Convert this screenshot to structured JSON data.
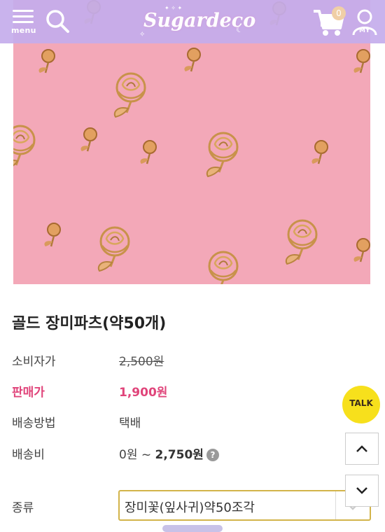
{
  "header": {
    "menu_label": "menu",
    "logo_text": "Sugardeco",
    "cart_count": "0",
    "my_label": "MY"
  },
  "product": {
    "title": "골드 장미파츠(약50개)",
    "retail_label": "소비자가",
    "retail_price": "2,500원",
    "sale_label": "판매가",
    "sale_price": "1,900원",
    "shipping_method_label": "배송방법",
    "shipping_method": "택배",
    "shipping_fee_label": "배송비",
    "shipping_fee_min": "0원 ~ ",
    "shipping_fee_max": "2,750원",
    "help_symbol": "?",
    "option_label": "종류",
    "option_selected": "장미꽃(잎사귀)약50조각"
  },
  "floating": {
    "talk_label": "TALK"
  },
  "colors": {
    "header_bg": "#c4acec",
    "sale": "#e0447a",
    "talk": "#f7e01c",
    "select_border": "#d2b44a",
    "product_bg": "#f3a8b8"
  }
}
